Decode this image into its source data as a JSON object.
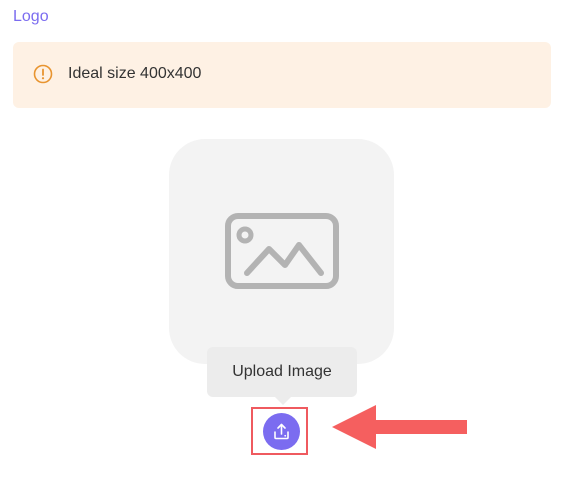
{
  "section": {
    "label": "Logo"
  },
  "notice": {
    "icon": "alert-circle-icon",
    "text": "Ideal size 400x400",
    "icon_color": "#e8942f",
    "background": "#fef1e4"
  },
  "dropzone": {
    "icon": "image-placeholder-icon",
    "background": "#f3f3f3"
  },
  "tooltip": {
    "text": "Upload Image"
  },
  "upload_button": {
    "icon": "upload-icon",
    "color": "#7b6cf0"
  },
  "annotation": {
    "highlight_color": "#ef5a5f",
    "arrow_icon": "left-arrow-icon"
  }
}
